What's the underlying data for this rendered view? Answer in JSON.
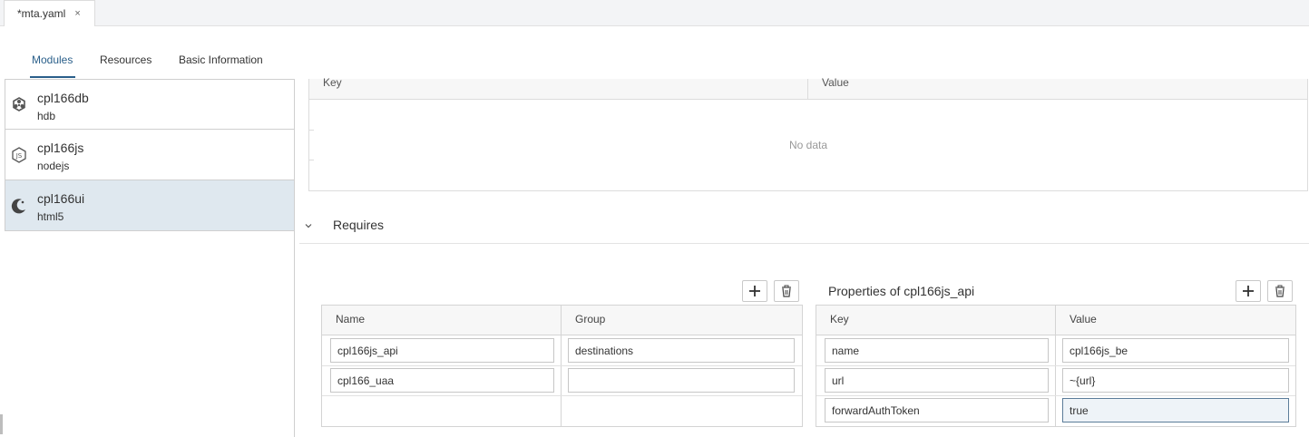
{
  "editor": {
    "file_tab": {
      "label": "*mta.yaml",
      "close": "×"
    }
  },
  "section_tabs": [
    {
      "label": "Modules",
      "active": true
    },
    {
      "label": "Resources",
      "active": false
    },
    {
      "label": "Basic Information",
      "active": false
    }
  ],
  "modules": [
    {
      "name": "cpl166db",
      "type": "hdb",
      "icon": "hdb-cube-icon",
      "selected": false
    },
    {
      "name": "cpl166js",
      "type": "nodejs",
      "icon": "nodejs-icon",
      "selected": false
    },
    {
      "name": "cpl166ui",
      "type": "html5",
      "icon": "html5-moon-icon",
      "selected": true
    }
  ],
  "properties_table": {
    "headers": {
      "key": "Key",
      "value": "Value"
    },
    "empty_text": "No data"
  },
  "requires": {
    "section_label": "Requires",
    "table": {
      "headers": {
        "name": "Name",
        "group": "Group"
      },
      "rows": [
        {
          "name": "cpl166js_api",
          "group": "destinations"
        },
        {
          "name": "cpl166_uaa",
          "group": ""
        }
      ]
    },
    "properties_of": {
      "title": "Properties of cpl166js_api",
      "headers": {
        "key": "Key",
        "value": "Value"
      },
      "rows": [
        {
          "key": "name",
          "value": "cpl166js_be"
        },
        {
          "key": "url",
          "value": "~{url}"
        },
        {
          "key": "forwardAuthToken",
          "value": "true"
        }
      ]
    }
  },
  "colors": {
    "accent": "#2a5f8a",
    "selected_row": "#dfe8ef"
  }
}
